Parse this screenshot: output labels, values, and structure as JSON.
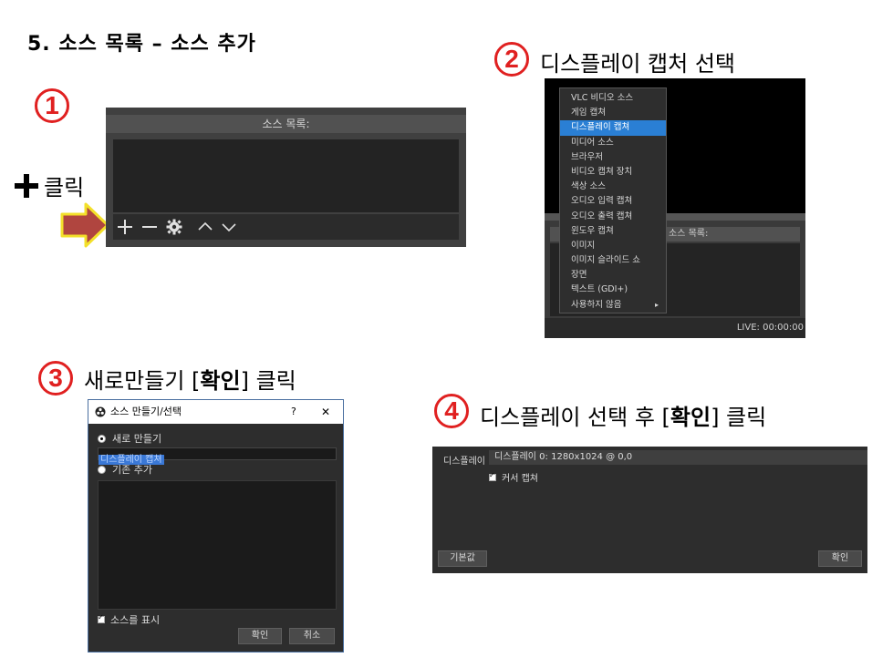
{
  "page": {
    "title": "5. 소스 목록 – 소스 추가"
  },
  "steps": {
    "s1": {
      "num": "1",
      "side_label": "클릭"
    },
    "s2": {
      "num": "2",
      "label": "디스플레이 캡처 선택"
    },
    "s3": {
      "num": "3",
      "label_pre": "새로만들기 [",
      "label_bold": "확인",
      "label_post": "] 클릭"
    },
    "s4": {
      "num": "4",
      "label_pre": "디스플레이 선택 후 [",
      "label_bold": "확인",
      "label_post": "] 클릭"
    }
  },
  "panel1": {
    "header": "소스 목록:",
    "toolbar": {
      "add": "add-icon",
      "remove": "minus-icon",
      "settings": "gear-icon",
      "up": "chevron-up-icon",
      "down": "chevron-down-icon"
    }
  },
  "panel2": {
    "source_header": "소스 목록:",
    "source_header_visible": "소스 목록:",
    "status": "LIVE: 00:00:00",
    "menu": [
      "VLC 비디오 소스",
      "게임 캡쳐",
      "디스플레이 캡쳐",
      "미디어 소스",
      "브라우저",
      "비디오 캡쳐 장치",
      "색상 소스",
      "오디오 입력 캡쳐",
      "오디오 출력 캡쳐",
      "윈도우 캡쳐",
      "이미지",
      "이미지 슬라이드 쇼",
      "장면",
      "텍스트 (GDI+)",
      "사용하지 않음"
    ],
    "selected_index": 2
  },
  "panel3": {
    "window_title": "소스 만들기/선택",
    "help": "?",
    "close": "✕",
    "new_option": "새로 만들기",
    "name_value": "디스플레이 캡쳐",
    "existing_option": "기존 추가",
    "visible_checkbox": "소스를 표시",
    "ok": "확인",
    "cancel": "취소"
  },
  "panel4": {
    "display_label": "디스플레이",
    "display_value": "디스플레이 0: 1280x1024 @ 0,0",
    "cursor_label": "커서 캡쳐",
    "defaults": "기본값",
    "ok": "확인"
  },
  "colors": {
    "accent": "#e02020",
    "selection": "#2a7fd4",
    "arrow_fill": "#b0453f",
    "arrow_border": "#f3e02a"
  }
}
